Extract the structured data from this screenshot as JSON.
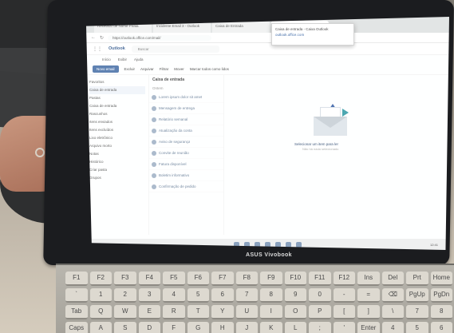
{
  "laptop": {
    "brand": "ASUS Vivobook"
  },
  "browser": {
    "tabs": [
      {
        "label": "Recebido de Nome Pirata"
      },
      {
        "label": "Incidente Email 3 - Outlook"
      },
      {
        "label": "Caixa de Entrada"
      },
      {
        "label": "Caixa de entrada - Microsoft Outlook"
      }
    ],
    "tab_popup": {
      "line1": "Caixa de entrada - Caixa Outlook",
      "line2": "outlook.office.com"
    },
    "url": "https://outlook.office.com/mail/"
  },
  "outlook": {
    "app_name": "Outlook",
    "search_placeholder": "Buscar",
    "menu": [
      "Início",
      "Exibir",
      "Ajuda"
    ],
    "ribbon": {
      "new_mail": "Novo email",
      "actions": [
        "Excluir",
        "Arquivar",
        "Filtrar",
        "Mover",
        "Marcar todos como lidos"
      ]
    },
    "folders": [
      "Favoritos",
      "Caixa de entrada",
      "Pastas",
      "Caixa de entrada",
      "Rascunhos",
      "Itens enviados",
      "Itens excluídos",
      "Lixo eletrônico",
      "Arquivo morto",
      "Notas",
      "Histórico",
      "Criar pasta",
      "Grupos"
    ],
    "list": {
      "header": "Caixa de entrada",
      "subheader": "Ontem",
      "messages": [
        "Lorem ipsum dolor sit amet",
        "Mensagem de entrega",
        "Relatório semanal",
        "Atualização da conta",
        "Aviso de segurança",
        "Convite de reunião",
        "Fatura disponível",
        "Boletim informativo",
        "Confirmação de pedido"
      ]
    },
    "reading_pane": {
      "title": "Selecionar um item para ler",
      "subtitle": "Não há nada selecionado"
    }
  },
  "taskbar": {
    "clock": "12:41"
  },
  "keyboard": {
    "keys": [
      "F1",
      "F2",
      "F3",
      "F4",
      "F5",
      "F6",
      "F7",
      "F8",
      "F9",
      "F10",
      "F11",
      "F12",
      "Ins",
      "Del",
      "Prt",
      "Home",
      "`",
      "1",
      "2",
      "3",
      "4",
      "5",
      "6",
      "7",
      "8",
      "9",
      "0",
      "-",
      "=",
      "⌫",
      "PgUp",
      "PgDn",
      "Tab",
      "Q",
      "W",
      "E",
      "R",
      "T",
      "Y",
      "U",
      "I",
      "O",
      "P",
      "[",
      "]",
      "\\",
      "7",
      "8",
      "Caps",
      "A",
      "S",
      "D",
      "F",
      "G",
      "H",
      "J",
      "K",
      "L",
      ";",
      "'",
      "Enter",
      "4",
      "5",
      "6"
    ]
  }
}
